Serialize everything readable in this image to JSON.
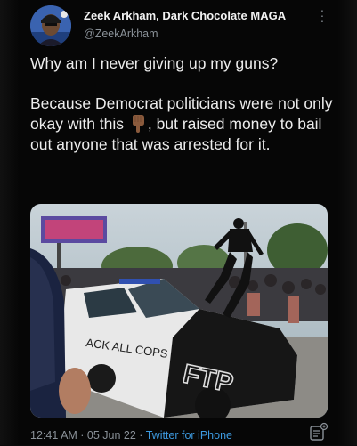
{
  "tweet": {
    "display_name": "Zeek Arkham, Dark Chocolate MAGA",
    "handle": "@ZeekArkham",
    "text_line1": "Why am I never giving up my guns?",
    "text_part2_before_emoji": "Because Democrat politicians were not only okay with this",
    "text_part2_after_emoji": ", but raised money to bail out anyone that was arrested for it.",
    "emoji_icon": "backhand-index-pointing-down",
    "timestamp": "12:41 AM · 05 Jun 22 · ",
    "source_app": "Twitter for iPhone"
  },
  "photo": {
    "car_graffiti_left": "ACK ALL COPS",
    "car_graffiti_hood": "FTP"
  },
  "colors": {
    "background": "#060606",
    "text": "#ececec",
    "secondary_text": "#8a9198",
    "link": "#3d9ae0"
  }
}
